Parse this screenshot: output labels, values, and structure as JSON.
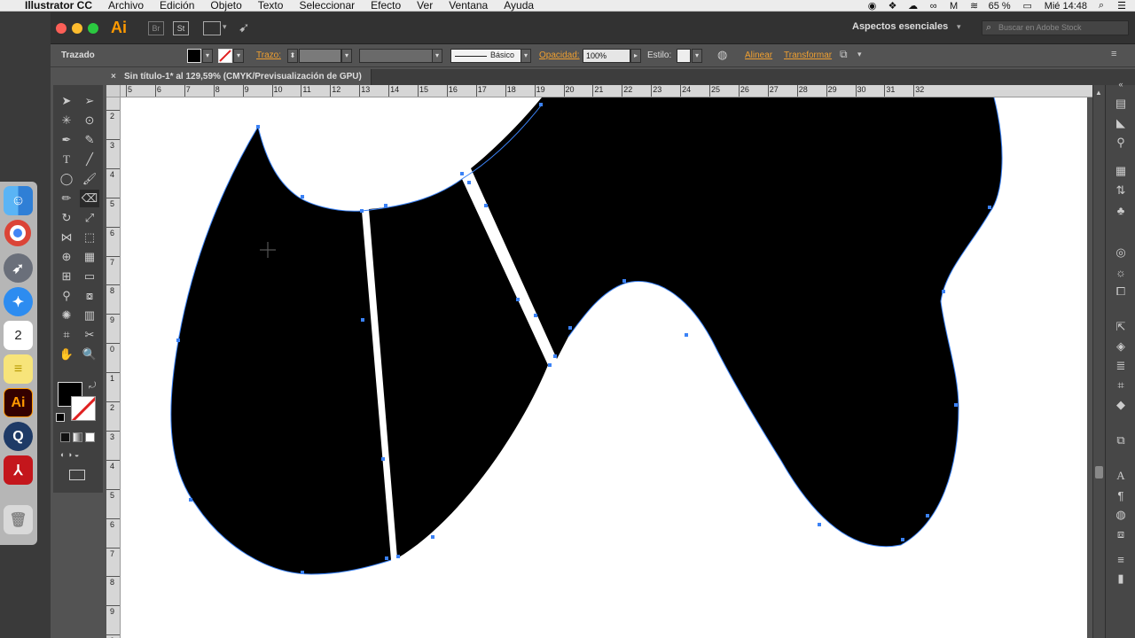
{
  "menubar": {
    "apple": "",
    "items": [
      "Illustrator CC",
      "Archivo",
      "Edición",
      "Objeto",
      "Texto",
      "Seleccionar",
      "Efecto",
      "Ver",
      "Ventana",
      "Ayuda"
    ],
    "battery": "65 %",
    "clock": "Mié 14:48"
  },
  "titlebar": {
    "app_logo": "Ai",
    "bridge": "Br",
    "stock": "St",
    "workspace": "Aspectos esenciales",
    "search_placeholder": "Buscar en Adobe Stock"
  },
  "controlbar": {
    "selection_label": "Trazado",
    "stroke_label": "Trazo:",
    "brush_label": "Básico",
    "opacity_label": "Opacidad:",
    "opacity_value": "100%",
    "style_label": "Estilo:",
    "align_label": "Alinear",
    "transform_label": "Transformar"
  },
  "document": {
    "tab_title": "Sin título-1* al 129,59% (CMYK/Previsualización de GPU)",
    "close_glyph": "×"
  },
  "rulers": {
    "horizontal": [
      "5",
      "6",
      "7",
      "8",
      "9",
      "10",
      "11",
      "12",
      "13",
      "14",
      "15",
      "16",
      "17",
      "18",
      "19",
      "20",
      "21",
      "22",
      "23",
      "24",
      "25",
      "26",
      "27",
      "28",
      "29",
      "30",
      "31",
      "32"
    ],
    "vertical": [
      "2",
      "3",
      "4",
      "5",
      "6",
      "7",
      "8",
      "9",
      "0",
      "1",
      "2",
      "3",
      "4",
      "5",
      "6",
      "7",
      "8",
      "9",
      "0"
    ]
  },
  "colors": {
    "canvas_bg": "#535353",
    "artboard": "#ffffff",
    "shape_fill": "#000000",
    "selection": "#3b82f6",
    "accent_orange": "#f0a030"
  }
}
